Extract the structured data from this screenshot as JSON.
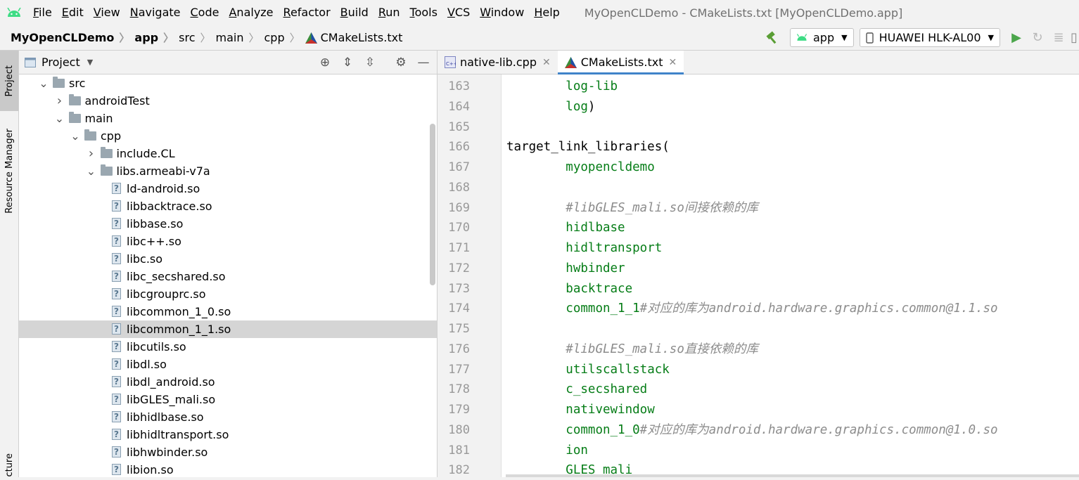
{
  "menubar": {
    "items": [
      "File",
      "Edit",
      "View",
      "Navigate",
      "Code",
      "Analyze",
      "Refactor",
      "Build",
      "Run",
      "Tools",
      "VCS",
      "Window",
      "Help"
    ],
    "window_title": "MyOpenCLDemo - CMakeLists.txt [MyOpenCLDemo.app]"
  },
  "breadcrumb": [
    "MyOpenCLDemo",
    "app",
    "src",
    "main",
    "cpp",
    "CMakeLists.txt"
  ],
  "toolbar": {
    "run_config": "app",
    "device": "HUAWEI HLK-AL00"
  },
  "left_strip": {
    "tab_project": "Project",
    "tab_resource_manager": "Resource Manager",
    "tab_structure": "cture"
  },
  "project": {
    "title": "Project",
    "tree": [
      {
        "label": "src",
        "type": "folder",
        "depth": 1,
        "expanded": true
      },
      {
        "label": "androidTest",
        "type": "folder",
        "depth": 2,
        "expanded": false
      },
      {
        "label": "main",
        "type": "folder",
        "depth": 2,
        "expanded": true
      },
      {
        "label": "cpp",
        "type": "folder",
        "depth": 3,
        "expanded": true
      },
      {
        "label": "include.CL",
        "type": "folder",
        "depth": 4,
        "expanded": false
      },
      {
        "label": "libs.armeabi-v7a",
        "type": "folder",
        "depth": 4,
        "expanded": true
      },
      {
        "label": "ld-android.so",
        "type": "file",
        "depth": 5
      },
      {
        "label": "libbacktrace.so",
        "type": "file",
        "depth": 5
      },
      {
        "label": "libbase.so",
        "type": "file",
        "depth": 5
      },
      {
        "label": "libc++.so",
        "type": "file",
        "depth": 5
      },
      {
        "label": "libc.so",
        "type": "file",
        "depth": 5
      },
      {
        "label": "libc_secshared.so",
        "type": "file",
        "depth": 5
      },
      {
        "label": "libcgrouprc.so",
        "type": "file",
        "depth": 5
      },
      {
        "label": "libcommon_1_0.so",
        "type": "file",
        "depth": 5
      },
      {
        "label": "libcommon_1_1.so",
        "type": "file",
        "depth": 5,
        "selected": true
      },
      {
        "label": "libcutils.so",
        "type": "file",
        "depth": 5
      },
      {
        "label": "libdl.so",
        "type": "file",
        "depth": 5
      },
      {
        "label": "libdl_android.so",
        "type": "file",
        "depth": 5
      },
      {
        "label": "libGLES_mali.so",
        "type": "file",
        "depth": 5
      },
      {
        "label": "libhidlbase.so",
        "type": "file",
        "depth": 5
      },
      {
        "label": "libhidltransport.so",
        "type": "file",
        "depth": 5
      },
      {
        "label": "libhwbinder.so",
        "type": "file",
        "depth": 5
      },
      {
        "label": "libion.so",
        "type": "file",
        "depth": 5
      }
    ]
  },
  "editor": {
    "tabs": [
      {
        "label": "native-lib.cpp",
        "active": false
      },
      {
        "label": "CMakeLists.txt",
        "active": true
      }
    ],
    "lines": [
      {
        "n": "163",
        "parts": [
          {
            "t": "        ",
            "c": "kw"
          },
          {
            "t": "log-lib",
            "c": "arg"
          }
        ]
      },
      {
        "n": "164",
        "parts": [
          {
            "t": "        ",
            "c": "kw"
          },
          {
            "t": "log",
            "c": "arg"
          },
          {
            "t": ")",
            "c": "kw"
          }
        ]
      },
      {
        "n": "165",
        "parts": []
      },
      {
        "n": "166",
        "parts": [
          {
            "t": "target_link_libraries(",
            "c": "kw"
          }
        ]
      },
      {
        "n": "167",
        "parts": [
          {
            "t": "        ",
            "c": "kw"
          },
          {
            "t": "myopencldemo",
            "c": "arg"
          }
        ]
      },
      {
        "n": "168",
        "parts": []
      },
      {
        "n": "169",
        "parts": [
          {
            "t": "        ",
            "c": "kw"
          },
          {
            "t": "#libGLES_mali.so间接依赖的库",
            "c": "cmt"
          }
        ]
      },
      {
        "n": "170",
        "parts": [
          {
            "t": "        ",
            "c": "kw"
          },
          {
            "t": "hidlbase",
            "c": "arg"
          }
        ]
      },
      {
        "n": "171",
        "parts": [
          {
            "t": "        ",
            "c": "kw"
          },
          {
            "t": "hidltransport",
            "c": "arg"
          }
        ]
      },
      {
        "n": "172",
        "parts": [
          {
            "t": "        ",
            "c": "kw"
          },
          {
            "t": "hwbinder",
            "c": "arg"
          }
        ]
      },
      {
        "n": "173",
        "parts": [
          {
            "t": "        ",
            "c": "kw"
          },
          {
            "t": "backtrace",
            "c": "arg"
          }
        ]
      },
      {
        "n": "174",
        "parts": [
          {
            "t": "        ",
            "c": "kw"
          },
          {
            "t": "common_1_1",
            "c": "arg"
          },
          {
            "t": "#对应的库为android.hardware.graphics.common@1.1.so",
            "c": "cmt"
          }
        ]
      },
      {
        "n": "175",
        "parts": []
      },
      {
        "n": "176",
        "parts": [
          {
            "t": "        ",
            "c": "kw"
          },
          {
            "t": "#libGLES_mali.so直接依赖的库",
            "c": "cmt"
          }
        ]
      },
      {
        "n": "177",
        "parts": [
          {
            "t": "        ",
            "c": "kw"
          },
          {
            "t": "utilscallstack",
            "c": "arg"
          }
        ]
      },
      {
        "n": "178",
        "parts": [
          {
            "t": "        ",
            "c": "kw"
          },
          {
            "t": "c_secshared",
            "c": "arg"
          }
        ]
      },
      {
        "n": "179",
        "parts": [
          {
            "t": "        ",
            "c": "kw"
          },
          {
            "t": "nativewindow",
            "c": "arg"
          }
        ]
      },
      {
        "n": "180",
        "parts": [
          {
            "t": "        ",
            "c": "kw"
          },
          {
            "t": "common_1_0",
            "c": "arg"
          },
          {
            "t": "#对应的库为android.hardware.graphics.common@1.0.so",
            "c": "cmt"
          }
        ]
      },
      {
        "n": "181",
        "parts": [
          {
            "t": "        ",
            "c": "kw"
          },
          {
            "t": "ion",
            "c": "arg"
          }
        ]
      },
      {
        "n": "182",
        "parts": [
          {
            "t": "        ",
            "c": "kw"
          },
          {
            "t": "GLES_mali",
            "c": "arg"
          }
        ]
      }
    ]
  },
  "colors": {
    "code_arg": "#067d17",
    "comment": "#8c8c8c",
    "tab_underline": "#4083c9",
    "selection": "#d5d5d5"
  }
}
